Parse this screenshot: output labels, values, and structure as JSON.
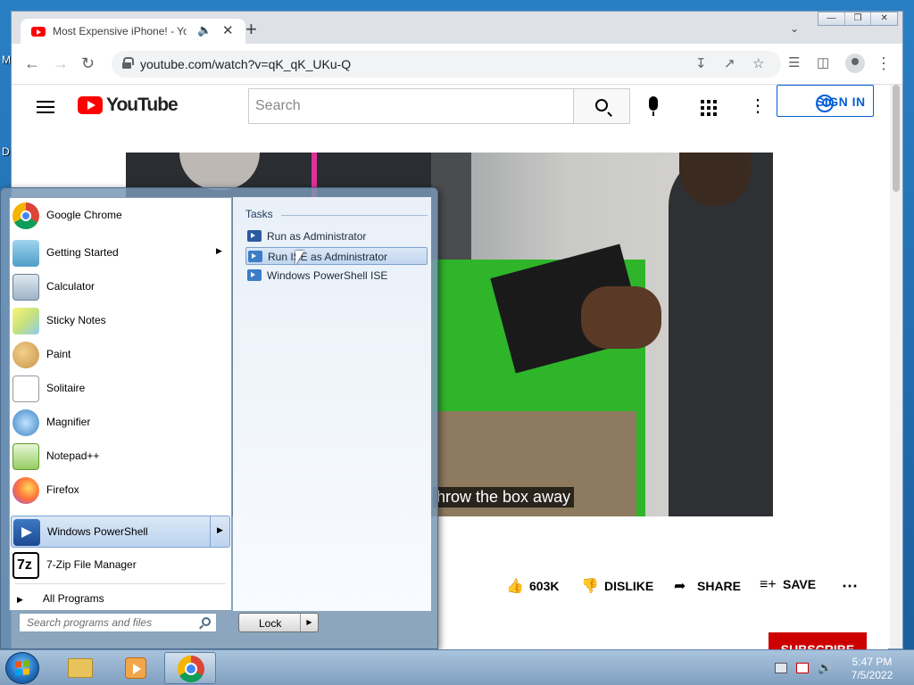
{
  "browser": {
    "tab": {
      "title": "Most Expensive iPhone! - Yo"
    },
    "url": "youtube.com/watch?v=qK_qK_UKu-Q"
  },
  "youtube": {
    "wordmark": "YouTube",
    "search_placeholder": "Search",
    "sign_in": "SIGN IN",
    "caption": "hrow the box away",
    "actions": {
      "likes": "603K",
      "dislike": "DISLIKE",
      "share": "SHARE",
      "save": "SAVE"
    },
    "subscribe": "SUBSCRIBE"
  },
  "start_menu": {
    "programs": [
      {
        "label": "Google Chrome",
        "icon": "chrome-icon"
      },
      {
        "label": "Getting Started",
        "icon": "getting-started-icon",
        "submenu": true
      },
      {
        "label": "Calculator",
        "icon": "calculator-icon"
      },
      {
        "label": "Sticky Notes",
        "icon": "sticky-notes-icon"
      },
      {
        "label": "Paint",
        "icon": "paint-icon"
      },
      {
        "label": "Solitaire",
        "icon": "solitaire-icon"
      },
      {
        "label": "Magnifier",
        "icon": "magnifier-icon"
      },
      {
        "label": "Notepad++",
        "icon": "notepad-plus-plus-icon"
      },
      {
        "label": "Firefox",
        "icon": "firefox-icon"
      },
      {
        "label": "Windows PowerShell",
        "icon": "powershell-icon",
        "submenu": true,
        "highlighted": true
      },
      {
        "label": "7-Zip File Manager",
        "icon": "7zip-icon"
      }
    ],
    "all_programs": "All Programs",
    "search_placeholder": "Search programs and files",
    "lock": "Lock",
    "tasks": {
      "heading": "Tasks",
      "items": [
        {
          "label": "Run as Administrator"
        },
        {
          "label": "Run ISE as Administrator",
          "highlighted": true
        },
        {
          "label": "Windows PowerShell ISE"
        }
      ]
    }
  },
  "taskbar": {
    "time": "5:47 PM",
    "date": "7/5/2022"
  },
  "colors": {
    "youtube_red": "#ff0000",
    "link_blue": "#065fd4",
    "subscribe_red": "#cc0000"
  }
}
